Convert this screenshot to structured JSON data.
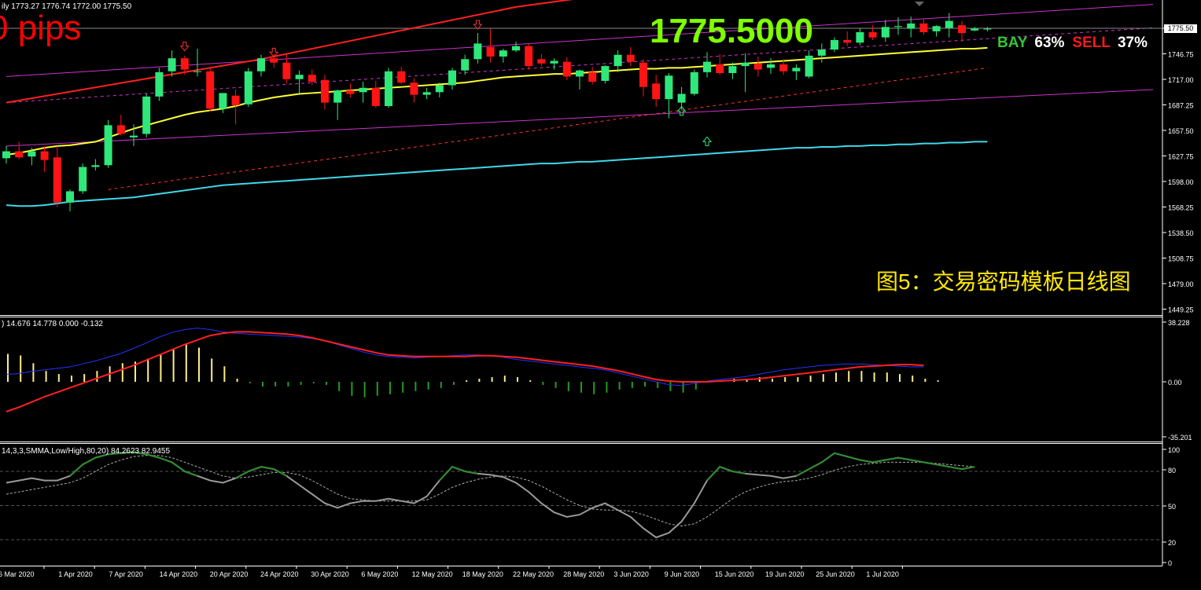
{
  "header": {
    "ohlc_text": "ily  1773.27 1776.74 1772.00 1775.50",
    "pips_text": "0 pips",
    "big_price": "1775.5000",
    "bay_label": "BAY",
    "bay_pct": "63%",
    "sell_label": "SELL",
    "sell_pct": "37%",
    "caption": "图5：交易密码模板日线图",
    "current_price_tag": "1775.50"
  },
  "price_axis": {
    "ticks": [
      "1775.50",
      "1746.75",
      "1717.00",
      "1687.25",
      "1657.50",
      "1627.75",
      "1598.00",
      "1568.25",
      "1538.50",
      "1508.75",
      "1479.00",
      "1449.25"
    ]
  },
  "macd": {
    "header": ") 14.676 14.778 0.000 -0.132",
    "ticks": [
      "38.228",
      "0.00",
      "-35.201"
    ]
  },
  "stoch": {
    "header": "14,3,3,SMMA,Low/High,80,20) 84.2623 82.9455",
    "ticks": [
      "100",
      "80",
      "50",
      "20",
      "0"
    ]
  },
  "time_axis": {
    "labels": [
      "6 Mar 2020",
      "1 Apr 2020",
      "7 Apr 2020",
      "14 Apr 2020",
      "20 Apr 2020",
      "24 Apr 2020",
      "30 Apr 2020",
      "6 May 2020",
      "12 May 2020",
      "18 May 2020",
      "22 May 2020",
      "28 May 2020",
      "3 Jun 2020",
      "9 Jun 2020",
      "15 Jun 2020",
      "19 Jun 2020",
      "25 Jun 2020",
      "1 Jul 2020"
    ]
  },
  "colors": {
    "up": "#2ee87a",
    "down": "#ff1414",
    "ma_yellow": "#ffff33",
    "ma_red": "#ff2020",
    "ma_cyan": "#40d8e8",
    "channel": "#cc33cc"
  },
  "chart_data": [
    {
      "type": "candlestick",
      "ylim": [
        1449.25,
        1800
      ],
      "candles": [
        {
          "o": 1626,
          "h": 1640,
          "l": 1620,
          "c": 1634
        },
        {
          "o": 1634,
          "h": 1645,
          "l": 1625,
          "c": 1627
        },
        {
          "o": 1628,
          "h": 1638,
          "l": 1618,
          "c": 1634
        },
        {
          "o": 1634,
          "h": 1640,
          "l": 1610,
          "c": 1624
        },
        {
          "o": 1627,
          "h": 1640,
          "l": 1570,
          "c": 1575
        },
        {
          "o": 1575,
          "h": 1590,
          "l": 1565,
          "c": 1588
        },
        {
          "o": 1588,
          "h": 1620,
          "l": 1585,
          "c": 1616
        },
        {
          "o": 1616,
          "h": 1625,
          "l": 1612,
          "c": 1618
        },
        {
          "o": 1618,
          "h": 1670,
          "l": 1615,
          "c": 1664
        },
        {
          "o": 1664,
          "h": 1676,
          "l": 1652,
          "c": 1654
        },
        {
          "o": 1650,
          "h": 1665,
          "l": 1640,
          "c": 1652
        },
        {
          "o": 1654,
          "h": 1700,
          "l": 1650,
          "c": 1697
        },
        {
          "o": 1697,
          "h": 1730,
          "l": 1692,
          "c": 1725
        },
        {
          "o": 1726,
          "h": 1750,
          "l": 1720,
          "c": 1741
        },
        {
          "o": 1741,
          "h": 1744,
          "l": 1722,
          "c": 1728
        },
        {
          "o": 1726,
          "h": 1752,
          "l": 1720,
          "c": 1726
        },
        {
          "o": 1726,
          "h": 1729,
          "l": 1680,
          "c": 1683
        },
        {
          "o": 1683,
          "h": 1700,
          "l": 1678,
          "c": 1701
        },
        {
          "o": 1698,
          "h": 1705,
          "l": 1665,
          "c": 1687
        },
        {
          "o": 1688,
          "h": 1730,
          "l": 1685,
          "c": 1726
        },
        {
          "o": 1726,
          "h": 1745,
          "l": 1720,
          "c": 1741
        },
        {
          "o": 1741,
          "h": 1746,
          "l": 1730,
          "c": 1736
        },
        {
          "o": 1736,
          "h": 1746,
          "l": 1712,
          "c": 1717
        },
        {
          "o": 1717,
          "h": 1727,
          "l": 1700,
          "c": 1722
        },
        {
          "o": 1722,
          "h": 1728,
          "l": 1710,
          "c": 1714
        },
        {
          "o": 1716,
          "h": 1722,
          "l": 1682,
          "c": 1690
        },
        {
          "o": 1690,
          "h": 1705,
          "l": 1670,
          "c": 1704
        },
        {
          "o": 1704,
          "h": 1712,
          "l": 1696,
          "c": 1700
        },
        {
          "o": 1702,
          "h": 1714,
          "l": 1690,
          "c": 1707
        },
        {
          "o": 1707,
          "h": 1715,
          "l": 1684,
          "c": 1686
        },
        {
          "o": 1686,
          "h": 1730,
          "l": 1684,
          "c": 1726
        },
        {
          "o": 1726,
          "h": 1731,
          "l": 1711,
          "c": 1713
        },
        {
          "o": 1713,
          "h": 1718,
          "l": 1690,
          "c": 1699
        },
        {
          "o": 1699,
          "h": 1707,
          "l": 1694,
          "c": 1702
        },
        {
          "o": 1702,
          "h": 1713,
          "l": 1696,
          "c": 1710
        },
        {
          "o": 1710,
          "h": 1730,
          "l": 1705,
          "c": 1727
        },
        {
          "o": 1727,
          "h": 1745,
          "l": 1722,
          "c": 1740
        },
        {
          "o": 1740,
          "h": 1770,
          "l": 1735,
          "c": 1758
        },
        {
          "o": 1754,
          "h": 1775,
          "l": 1736,
          "c": 1743
        },
        {
          "o": 1743,
          "h": 1752,
          "l": 1736,
          "c": 1750
        },
        {
          "o": 1750,
          "h": 1760,
          "l": 1748,
          "c": 1755
        },
        {
          "o": 1755,
          "h": 1758,
          "l": 1728,
          "c": 1732
        },
        {
          "o": 1740,
          "h": 1746,
          "l": 1732,
          "c": 1735
        },
        {
          "o": 1735,
          "h": 1741,
          "l": 1728,
          "c": 1738
        },
        {
          "o": 1737,
          "h": 1742,
          "l": 1716,
          "c": 1720
        },
        {
          "o": 1720,
          "h": 1728,
          "l": 1705,
          "c": 1727
        },
        {
          "o": 1725,
          "h": 1731,
          "l": 1711,
          "c": 1714
        },
        {
          "o": 1715,
          "h": 1733,
          "l": 1712,
          "c": 1732
        },
        {
          "o": 1732,
          "h": 1750,
          "l": 1725,
          "c": 1745
        },
        {
          "o": 1745,
          "h": 1754,
          "l": 1732,
          "c": 1737
        },
        {
          "o": 1736,
          "h": 1740,
          "l": 1697,
          "c": 1708
        },
        {
          "o": 1712,
          "h": 1722,
          "l": 1685,
          "c": 1694
        },
        {
          "o": 1694,
          "h": 1724,
          "l": 1672,
          "c": 1721
        },
        {
          "o": 1690,
          "h": 1708,
          "l": 1682,
          "c": 1700
        },
        {
          "o": 1700,
          "h": 1728,
          "l": 1698,
          "c": 1725
        },
        {
          "o": 1725,
          "h": 1748,
          "l": 1719,
          "c": 1737
        },
        {
          "o": 1734,
          "h": 1746,
          "l": 1722,
          "c": 1724
        },
        {
          "o": 1724,
          "h": 1736,
          "l": 1717,
          "c": 1732
        },
        {
          "o": 1732,
          "h": 1747,
          "l": 1702,
          "c": 1736
        },
        {
          "o": 1735,
          "h": 1743,
          "l": 1720,
          "c": 1728
        },
        {
          "o": 1730,
          "h": 1741,
          "l": 1723,
          "c": 1734
        },
        {
          "o": 1734,
          "h": 1740,
          "l": 1722,
          "c": 1726
        },
        {
          "o": 1726,
          "h": 1734,
          "l": 1716,
          "c": 1730
        },
        {
          "o": 1720,
          "h": 1750,
          "l": 1718,
          "c": 1744
        },
        {
          "o": 1744,
          "h": 1758,
          "l": 1736,
          "c": 1751
        },
        {
          "o": 1751,
          "h": 1765,
          "l": 1748,
          "c": 1762
        },
        {
          "o": 1762,
          "h": 1772,
          "l": 1755,
          "c": 1759
        },
        {
          "o": 1759,
          "h": 1776,
          "l": 1756,
          "c": 1771
        },
        {
          "o": 1771,
          "h": 1779,
          "l": 1762,
          "c": 1765
        },
        {
          "o": 1765,
          "h": 1785,
          "l": 1760,
          "c": 1777
        },
        {
          "o": 1777,
          "h": 1788,
          "l": 1768,
          "c": 1778
        },
        {
          "o": 1775,
          "h": 1789,
          "l": 1765,
          "c": 1781
        },
        {
          "o": 1781,
          "h": 1786,
          "l": 1768,
          "c": 1771
        },
        {
          "o": 1772,
          "h": 1779,
          "l": 1766,
          "c": 1778
        },
        {
          "o": 1776,
          "h": 1793,
          "l": 1765,
          "c": 1784
        },
        {
          "o": 1779,
          "h": 1784,
          "l": 1760,
          "c": 1770
        },
        {
          "o": 1773,
          "h": 1777,
          "l": 1772,
          "c": 1775
        },
        {
          "o": 1775,
          "h": 1777,
          "l": 1772,
          "c": 1775
        }
      ],
      "ma_yellow": [
        1630,
        1632,
        1635,
        1638,
        1640,
        1641,
        1643,
        1645,
        1650,
        1655,
        1660,
        1664,
        1668,
        1672,
        1676,
        1679,
        1681,
        1683,
        1686,
        1690,
        1693,
        1696,
        1698,
        1700,
        1701,
        1702,
        1703,
        1704,
        1705,
        1706,
        1707,
        1708,
        1709,
        1710,
        1711,
        1712,
        1713,
        1715,
        1717,
        1719,
        1720,
        1721,
        1722,
        1723,
        1723,
        1724,
        1725,
        1726,
        1727,
        1728,
        1729,
        1729,
        1730,
        1730,
        1731,
        1732,
        1733,
        1734,
        1735,
        1736,
        1737,
        1738,
        1739,
        1740,
        1741,
        1742,
        1743,
        1744,
        1745,
        1746,
        1747,
        1748,
        1749,
        1750,
        1751,
        1752,
        1752,
        1753
      ],
      "ma_cyan": [
        1572,
        1571,
        1571,
        1572,
        1574,
        1576,
        1577,
        1578,
        1579,
        1580,
        1581,
        1583,
        1585,
        1587,
        1589,
        1591,
        1593,
        1595,
        1596,
        1597,
        1598,
        1599,
        1600,
        1601,
        1602,
        1603,
        1604,
        1605,
        1606,
        1607,
        1608,
        1609,
        1610,
        1611,
        1612,
        1613,
        1614,
        1615,
        1616,
        1617,
        1618,
        1619,
        1620,
        1620,
        1621,
        1622,
        1622,
        1623,
        1624,
        1625,
        1626,
        1627,
        1628,
        1629,
        1630,
        1631,
        1632,
        1633,
        1634,
        1635,
        1636,
        1637,
        1638,
        1638,
        1639,
        1639,
        1640,
        1640,
        1641,
        1641,
        1642,
        1642,
        1643,
        1643,
        1644,
        1644,
        1645,
        1645
      ],
      "ma_red_series": {
        "x": [
          0,
          20,
          40,
          60,
          70,
          78
        ],
        "y": [
          1690,
          1740,
          1800,
          1840,
          1860,
          1875
        ]
      },
      "trendlines": [
        {
          "name": "upper",
          "from": {
            "x": 0,
            "y": 1720
          },
          "to": {
            "x": 90,
            "y": 1803
          }
        },
        {
          "name": "mid",
          "from": {
            "x": 0,
            "y": 1690
          },
          "to": {
            "x": 90,
            "y": 1776
          }
        },
        {
          "name": "lower",
          "from": {
            "x": 0,
            "y": 1640
          },
          "to": {
            "x": 90,
            "y": 1705
          }
        },
        {
          "name": "red-dashed",
          "from": {
            "x": 8,
            "y": 1590
          },
          "to": {
            "x": 77,
            "y": 1730
          }
        }
      ],
      "price_line": 1775.5,
      "arrows_up": [
        {
          "i": 55,
          "y": 1645
        },
        {
          "i": 53,
          "y": 1680
        }
      ],
      "arrows_down": [
        {
          "i": 14,
          "y": 1755
        },
        {
          "i": 21,
          "y": 1748
        },
        {
          "i": 37,
          "y": 1780
        }
      ]
    },
    {
      "type": "bar",
      "ylim": [
        -35.201,
        38.228
      ],
      "histogram": [
        18,
        17,
        12,
        7,
        5,
        4,
        5,
        7,
        10,
        12,
        13,
        15,
        18,
        21,
        24,
        22,
        15,
        10,
        2,
        -1,
        -3,
        -3,
        -3,
        -2,
        -1,
        -2,
        -6,
        -9,
        -10,
        -9,
        -8,
        -7,
        -6,
        -5,
        -4,
        -2,
        1,
        2,
        3,
        4,
        3,
        1,
        -2,
        -4,
        -6,
        -7,
        -8,
        -7,
        -5,
        -4,
        -3,
        -4,
        -6,
        -7,
        -5,
        0,
        1,
        2,
        2,
        3,
        2,
        3,
        3,
        4,
        5,
        6,
        7,
        7,
        6,
        6,
        5,
        4,
        2,
        1,
        0
      ]
    }
  ]
}
